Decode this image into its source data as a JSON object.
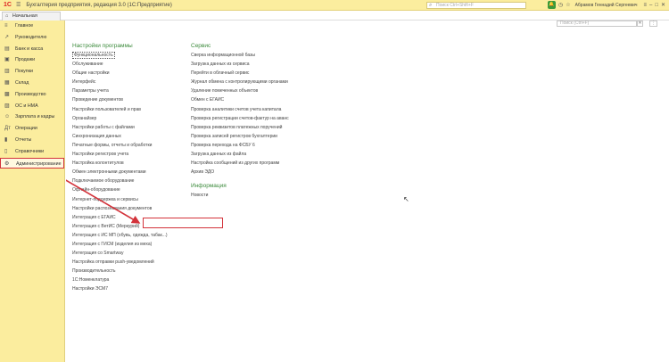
{
  "titlebar": {
    "logo": "1С",
    "title": "Бухгалтерия предприятия, редакция 3.0  (1С:Предприятие)",
    "search_placeholder": "Поиск Ctrl+Shift+F",
    "user": "Абрамов Геннадий Сергеевич"
  },
  "tabbar": {
    "home_label": "Начальная страница"
  },
  "sidebar": {
    "items": [
      {
        "icon": "≡",
        "label": "Главное"
      },
      {
        "icon": "↗",
        "label": "Руководителю"
      },
      {
        "icon": "▤",
        "label": "Банк и касса"
      },
      {
        "icon": "▣",
        "label": "Продажи"
      },
      {
        "icon": "▥",
        "label": "Покупки"
      },
      {
        "icon": "▦",
        "label": "Склад"
      },
      {
        "icon": "▩",
        "label": "Производство"
      },
      {
        "icon": "▨",
        "label": "ОС и НМА"
      },
      {
        "icon": "☺",
        "label": "Зарплата и кадры"
      },
      {
        "icon": "Дт",
        "label": "Операции"
      },
      {
        "icon": "▮",
        "label": "Отчеты"
      },
      {
        "icon": "▯",
        "label": "Справочники"
      },
      {
        "icon": "⚙",
        "label": "Администрирование"
      }
    ]
  },
  "content": {
    "search_placeholder": "Поиск (Ctrl+F)",
    "settings": {
      "title": "Настройки программы",
      "items": [
        "Функциональность",
        "Обслуживание",
        "Общие настройки",
        "Интерфейс",
        "Параметры учета",
        "Проведение документов",
        "Настройки пользователей и прав",
        "Органайзер",
        "Настройки работы с файлами",
        "Синхронизация данных",
        "Печатные формы, отчеты и обработки",
        "Настройки регистров учета",
        "Настройка колонтитулов",
        "Обмен электронными документами",
        "Подключаемое оборудование",
        "Офлайн-оборудование",
        "Интернет-поддержка и сервисы",
        "Настройки распознавания документов",
        "Интеграция с ЕГАИС",
        "Интеграция с ВетИС (Меркурий)",
        "Интеграция с ИС МП (обувь, одежда, табак...)",
        "Интеграция с ГИСМ (изделия из меха)",
        "Интеграция со Smartway",
        "Настройка отправки push-уведомлений",
        "Производительность",
        "1С:Номенклатура",
        "Настройки ЭСМ7"
      ]
    },
    "service": {
      "title": "Сервис",
      "items": [
        "Сверка информационной базы",
        "Загрузка данных из сервиса",
        "Перейти в облачный сервис",
        "Журнал обмена с контролирующими органами",
        "Удаление помеченных объектов",
        "Обмен с ЕГАИС",
        "Проверка аналитики счетов учета капитала",
        "Проверка регистрации счетов-фактур на аванс",
        "Проверка реквизитов платежных поручений",
        "Проверка записей регистров бухгалтерии",
        "Проверка перехода на ФСБУ 6",
        "Загрузка данных из файла",
        "Настройка сообщений из других программ",
        "Архив ЭДО"
      ]
    },
    "info": {
      "title": "Информация",
      "items": [
        "Новости"
      ]
    }
  }
}
